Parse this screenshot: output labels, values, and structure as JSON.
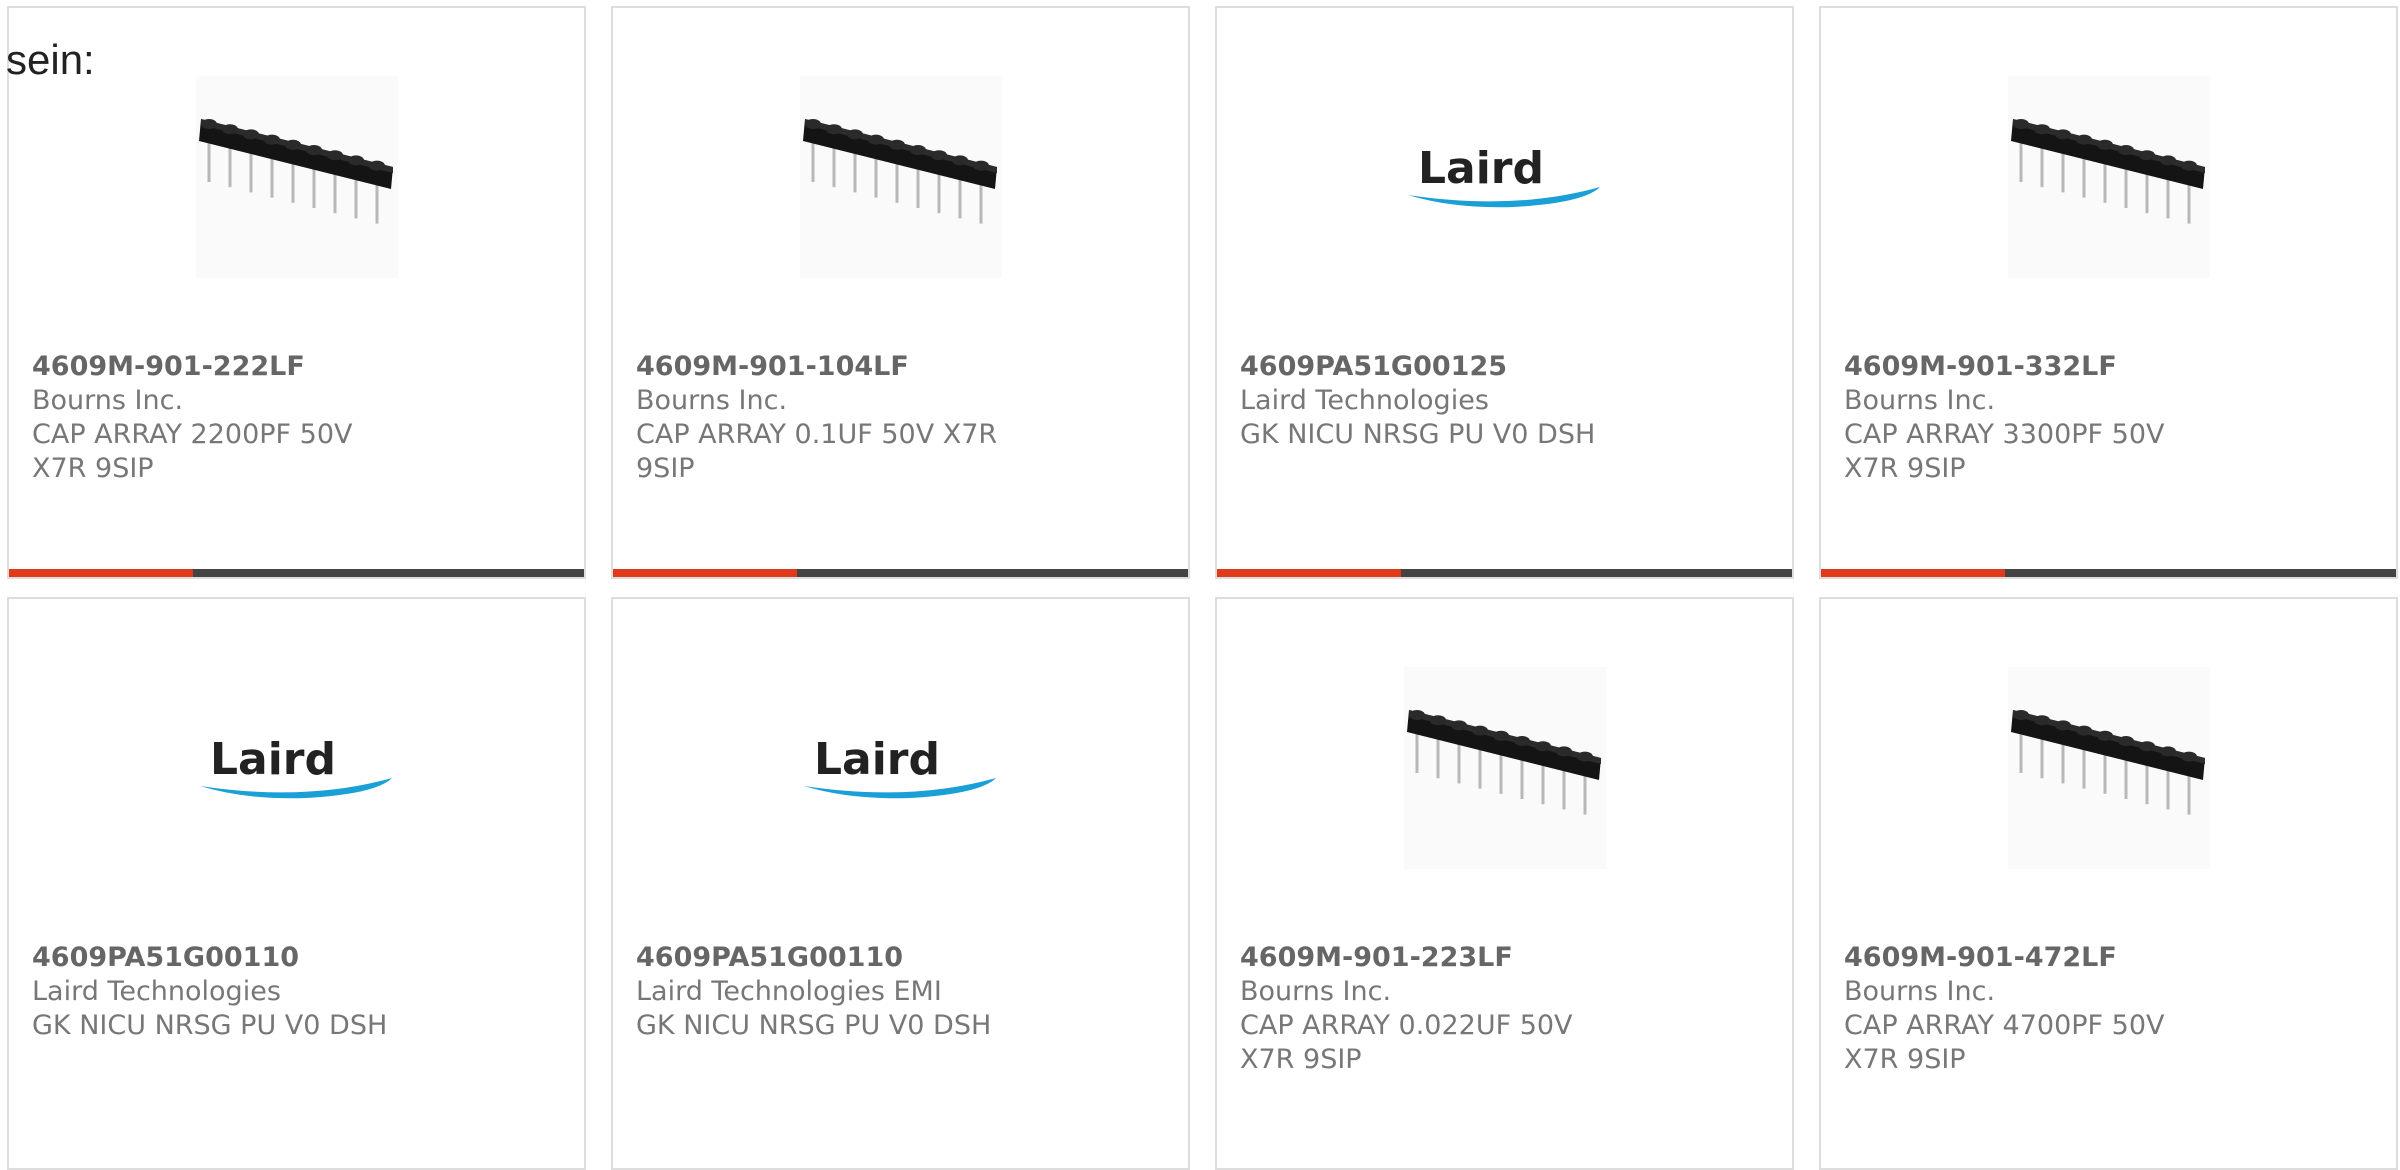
{
  "intro_text": "sein:",
  "colors": {
    "accent": "#e03a1b",
    "bar_track": "#444444",
    "laird_blue": "#1aa0d6"
  },
  "products": [
    {
      "part": "4609M-901-222LF",
      "manufacturer": "Bourns Inc.",
      "description": "CAP ARRAY 2200PF 50V X7R 9SIP",
      "image": "sip-resistor-array",
      "progress": 0.32
    },
    {
      "part": "4609M-901-104LF",
      "manufacturer": "Bourns Inc.",
      "description": "CAP ARRAY 0.1UF 50V X7R 9SIP",
      "image": "sip-resistor-array",
      "progress": 0.32
    },
    {
      "part": "4609PA51G00125",
      "manufacturer": "Laird Technologies",
      "description": "GK NICU NRSG PU V0 DSH",
      "image": "laird-logo",
      "logo_text": "Laird",
      "progress": 0.32
    },
    {
      "part": "4609M-901-332LF",
      "manufacturer": "Bourns Inc.",
      "description": "CAP ARRAY 3300PF 50V X7R 9SIP",
      "image": "sip-resistor-array",
      "progress": 0.32
    },
    {
      "part": "4609PA51G00110",
      "manufacturer": "Laird Technologies",
      "description": "GK NICU NRSG PU V0 DSH",
      "image": "laird-logo",
      "logo_text": "Laird"
    },
    {
      "part": "4609PA51G00110",
      "manufacturer": "Laird Technologies EMI",
      "description": "GK NICU NRSG PU V0 DSH",
      "image": "laird-logo",
      "logo_text": "Laird"
    },
    {
      "part": "4609M-901-223LF",
      "manufacturer": "Bourns Inc.",
      "description": "CAP ARRAY 0.022UF 50V X7R 9SIP",
      "image": "sip-resistor-array"
    },
    {
      "part": "4609M-901-472LF",
      "manufacturer": "Bourns Inc.",
      "description": "CAP ARRAY 4700PF 50V X7R 9SIP",
      "image": "sip-resistor-array"
    }
  ]
}
